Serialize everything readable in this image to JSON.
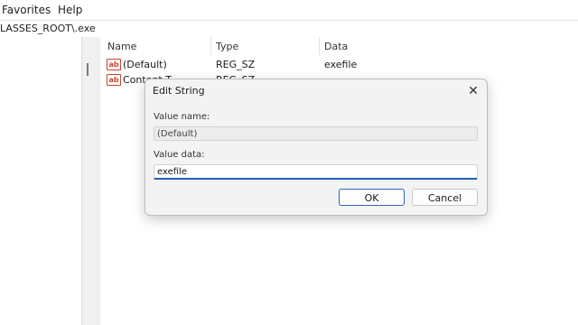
{
  "menu": {
    "favorites_label": "Favorites",
    "help_label": "Help"
  },
  "address": {
    "path": "LASSES_ROOT\\.exe"
  },
  "list": {
    "columns": {
      "name": "Name",
      "type": "Type",
      "data": "Data"
    },
    "rows": [
      {
        "name": "(Default)",
        "type": "REG_SZ",
        "data": "exefile"
      },
      {
        "name": "Content T",
        "type": "REG_SZ",
        "data": ""
      }
    ]
  },
  "dialog": {
    "title": "Edit String",
    "value_name_label": "Value name:",
    "value_name": "(Default)",
    "value_data_label": "Value data:",
    "value_data": "exefile",
    "ok_label": "OK",
    "cancel_label": "Cancel"
  },
  "icons": {
    "string_value": "ab",
    "close": "✕"
  },
  "colors": {
    "accent": "#1f5fb5",
    "icon_red": "#c8452c"
  }
}
